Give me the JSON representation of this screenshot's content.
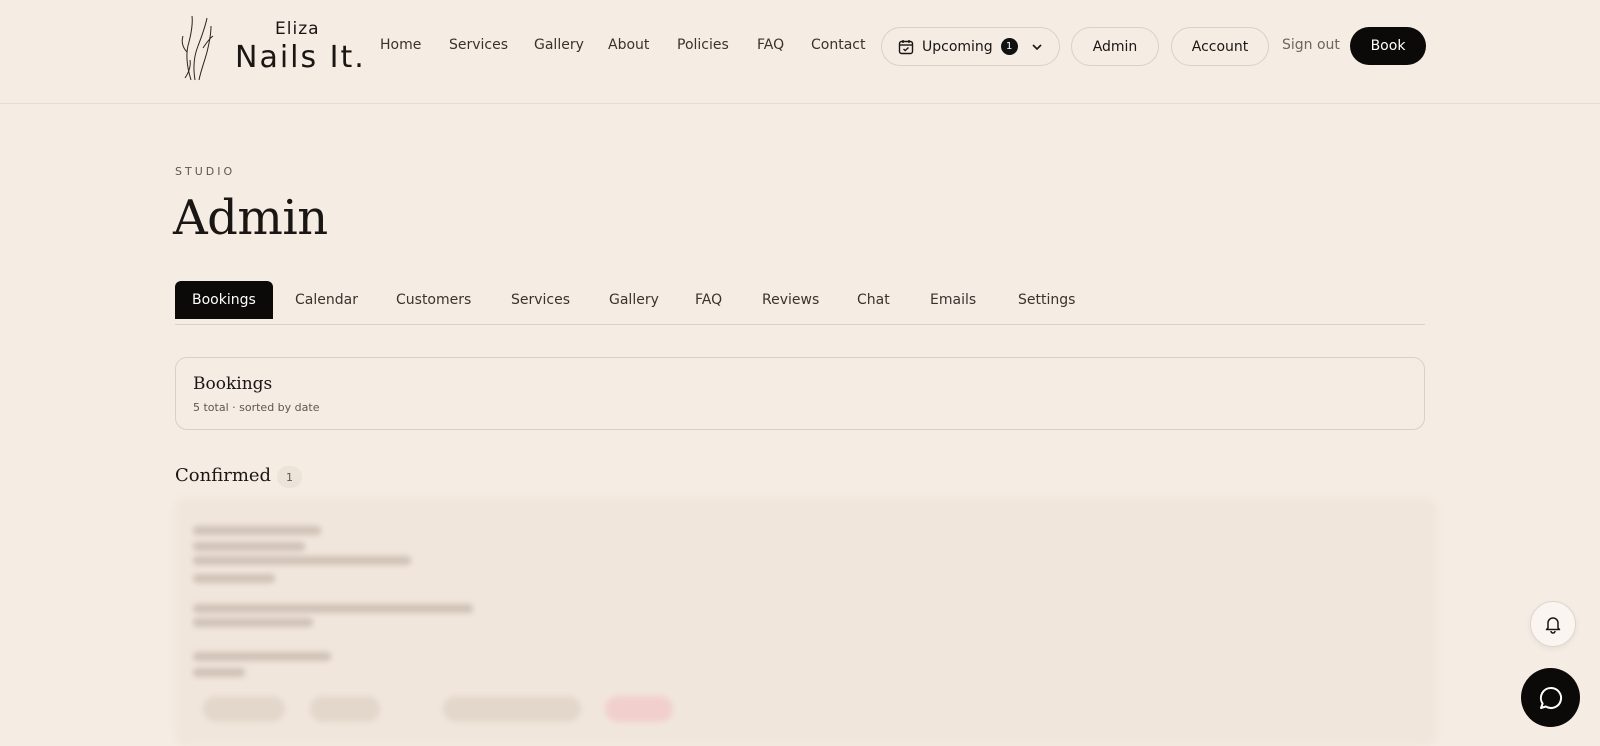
{
  "brand": {
    "line1": "Eliza",
    "line2": "Nails It."
  },
  "nav": {
    "items": [
      {
        "label": "Home"
      },
      {
        "label": "Services"
      },
      {
        "label": "Gallery"
      },
      {
        "label": "About"
      },
      {
        "label": "Policies"
      },
      {
        "label": "FAQ"
      },
      {
        "label": "Contact"
      }
    ],
    "upcoming": {
      "label": "Upcoming",
      "count": "1",
      "icon": "calendar-icon"
    },
    "admin_label": "Admin",
    "account_label": "Account",
    "signout_label": "Sign out",
    "book_label": "Book"
  },
  "page": {
    "eyebrow": "STUDIO",
    "title": "Admin"
  },
  "tabs": [
    {
      "label": "Bookings",
      "active": true
    },
    {
      "label": "Calendar"
    },
    {
      "label": "Customers"
    },
    {
      "label": "Services"
    },
    {
      "label": "Gallery"
    },
    {
      "label": "FAQ"
    },
    {
      "label": "Reviews"
    },
    {
      "label": "Chat"
    },
    {
      "label": "Emails"
    },
    {
      "label": "Settings"
    }
  ],
  "bookings_card": {
    "title": "Bookings",
    "subtitle": "5 total · sorted by date"
  },
  "confirmed": {
    "title": "Confirmed",
    "count": "1"
  },
  "floating": {
    "bell_icon": "bell-icon",
    "chat_icon": "chat-bubble-icon"
  },
  "colors": {
    "background": "#f5ece3",
    "accent": "#0c0a09"
  }
}
